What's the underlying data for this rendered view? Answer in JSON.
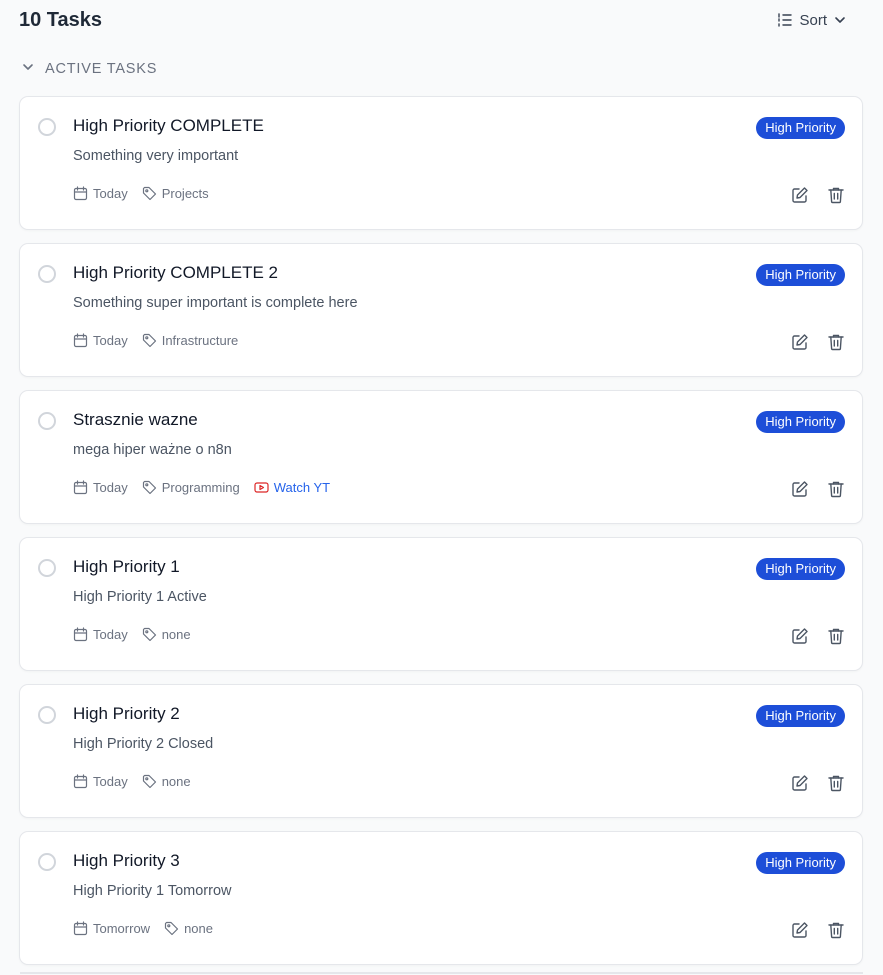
{
  "header": {
    "title": "10 Tasks",
    "sort_label": "Sort"
  },
  "section": {
    "label": "ACTIVE TASKS"
  },
  "colors": {
    "badge": "#1d4ed8",
    "link": "#2563eb",
    "youtube_icon": "#dc2626"
  },
  "tasks": [
    {
      "title": "High Priority COMPLETE",
      "description": "Something very important",
      "priority": "High Priority",
      "due": "Today",
      "tag": "Projects",
      "link": null
    },
    {
      "title": "High Priority COMPLETE 2",
      "description": "Something super important is complete here",
      "priority": "High Priority",
      "due": "Today",
      "tag": "Infrastructure",
      "link": null
    },
    {
      "title": "Strasznie wazne",
      "description": "mega hiper ważne o n8n",
      "priority": "High Priority",
      "due": "Today",
      "tag": "Programming",
      "link": "Watch YT"
    },
    {
      "title": "High Priority 1",
      "description": "High Priority 1 Active",
      "priority": "High Priority",
      "due": "Today",
      "tag": "none",
      "link": null
    },
    {
      "title": "High Priority 2",
      "description": "High Priority 2 Closed",
      "priority": "High Priority",
      "due": "Today",
      "tag": "none",
      "link": null
    },
    {
      "title": "High Priority 3",
      "description": "High Priority 1 Tomorrow",
      "priority": "High Priority",
      "due": "Tomorrow",
      "tag": "none",
      "link": null
    }
  ]
}
